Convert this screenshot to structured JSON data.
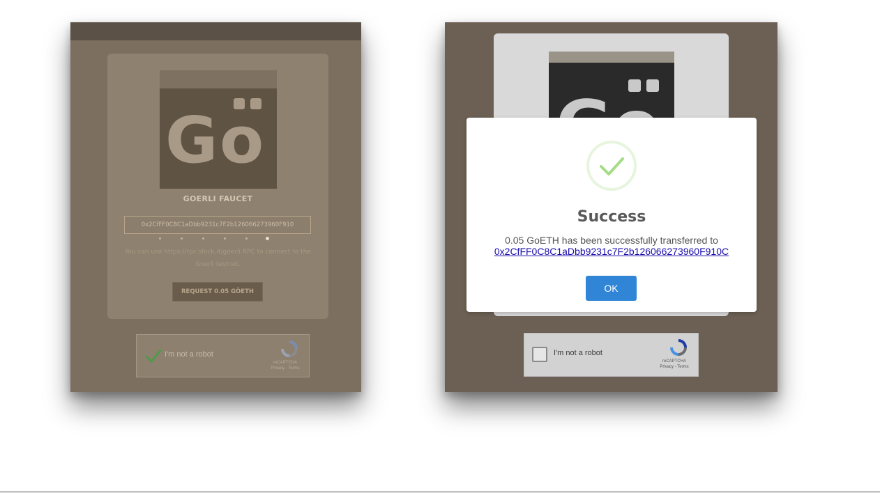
{
  "left_screen": {
    "faucet_title": "GOERLI FAUCET",
    "address_value": "0x2CfFF0C8C1aDbb9231c7F2b126066273960F910",
    "rpc_note": "You can use https://rpc.slock.it/goerli RPC to connect to the Goerli testnet.",
    "request_button_label": "REQUEST 0.05 GÖETH",
    "carousel": {
      "count": 6,
      "active_index": 5
    },
    "recaptcha": {
      "label": "I'm not a robot",
      "brand": "reCAPTCHA",
      "links": "Privacy - Terms",
      "checked": true
    }
  },
  "right_screen": {
    "modal": {
      "title": "Success",
      "message": "0.05 GoETH has been successfully transferred to",
      "address_link": "0x2CfFF0C8C1aDbb9231c7F2b126066273960F910C",
      "ok_label": "OK"
    },
    "recaptcha": {
      "label": "I'm not a robot",
      "brand": "reCAPTCHA",
      "links": "Privacy - Terms",
      "checked": false
    }
  },
  "colors": {
    "overlay_brown": "#7d6f5f",
    "success_green": "#a5dc86",
    "ok_blue": "#3085d6",
    "link_blue": "#1a0dab"
  },
  "icons": {
    "logo": "goerli-logo-icon",
    "check": "check-icon",
    "recaptcha": "recaptcha-logo-icon",
    "success": "success-check-icon"
  }
}
